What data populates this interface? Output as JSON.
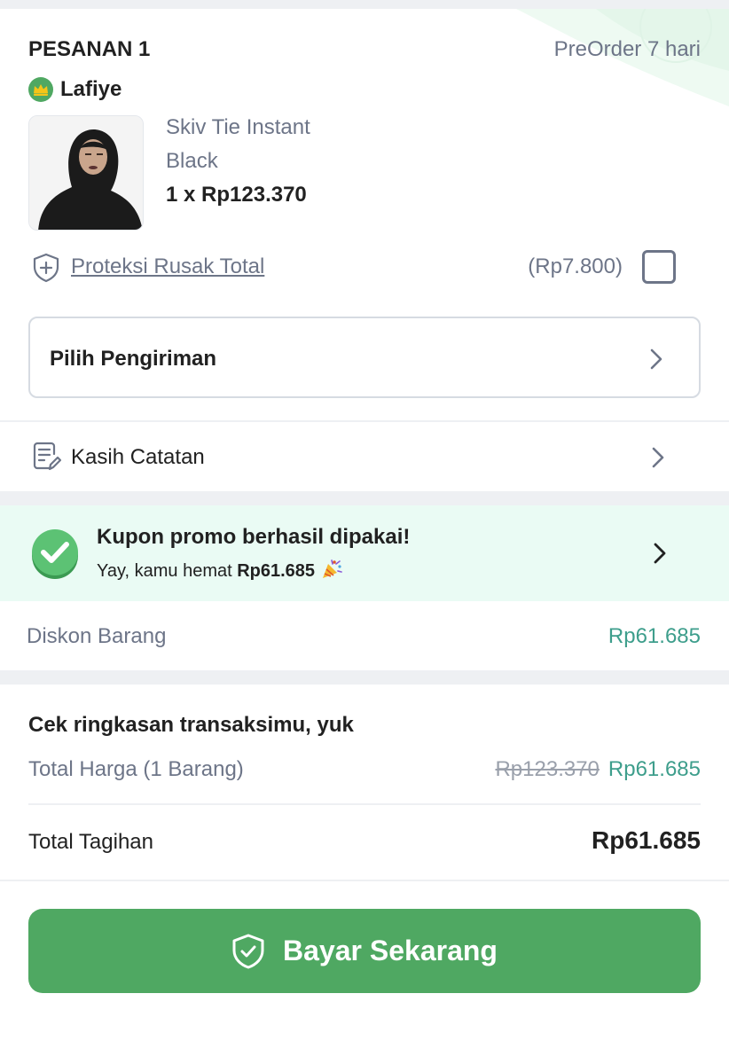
{
  "order": {
    "title": "PESANAN 1",
    "badge": "PreOrder 7 hari"
  },
  "shop": {
    "name": "Lafiye",
    "icon": "crown-badge-icon"
  },
  "product": {
    "name": "Skiv Tie Instant",
    "variant": "Black",
    "price_line": "1 x Rp123.370"
  },
  "protection": {
    "label": "Proteksi Rusak Total",
    "price": "(Rp7.800)",
    "checked": false,
    "icon": "shield-plus-icon"
  },
  "shipping": {
    "label": "Pilih Pengiriman"
  },
  "note": {
    "label": "Kasih Catatan",
    "icon": "note-edit-icon"
  },
  "promo": {
    "title": "Kupon promo berhasil dipakai!",
    "subtitle_prefix": "Yay, kamu hemat",
    "subtitle_amount": "Rp61.685",
    "icon": "check-circle-icon",
    "emoji": "party-popper-icon"
  },
  "discount": {
    "label": "Diskon Barang",
    "value": "Rp61.685"
  },
  "summary": {
    "title": "Cek ringkasan transaksimu, yuk",
    "total_price_label": "Total Harga (1 Barang)",
    "total_price_old": "Rp123.370",
    "total_price_new": "Rp61.685",
    "bill_label": "Total Tagihan",
    "bill_value": "Rp61.685"
  },
  "pay_button": {
    "label": "Bayar Sekarang",
    "icon": "shield-check-icon"
  },
  "colors": {
    "accent_green": "#4fa862",
    "promo_bg": "#eafbf4",
    "price_teal": "#3e9e8c",
    "muted_text": "#6d7588"
  }
}
